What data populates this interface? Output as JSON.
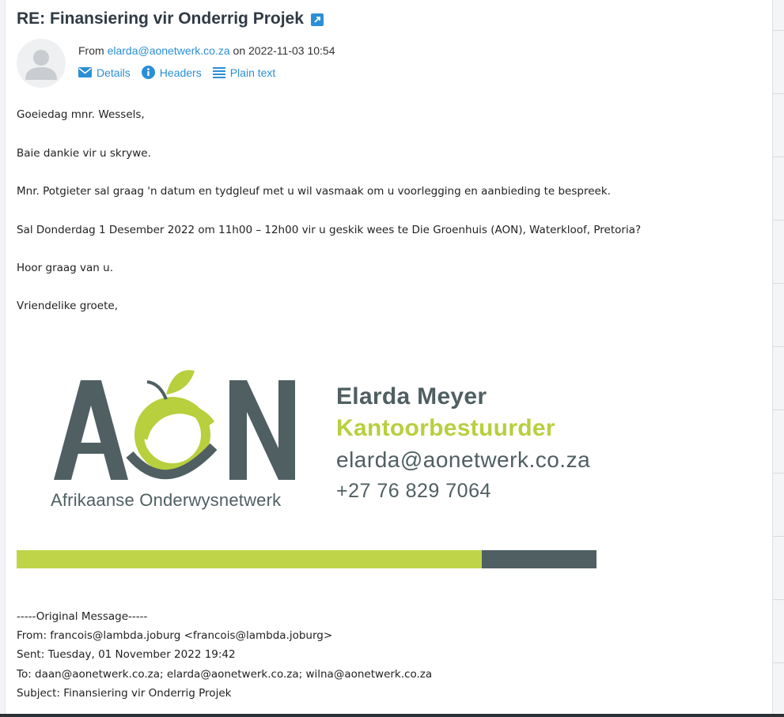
{
  "message": {
    "subject": "RE: Finansiering vir Onderrig Projek",
    "from_prefix": "From",
    "from_email": "elarda@aonetwerk.co.za",
    "date_text": "on 2022-11-03 10:54",
    "actions": {
      "details": "Details",
      "headers": "Headers",
      "plain_text": "Plain text"
    }
  },
  "body": {
    "lines": [
      "Goeiedag mnr. Wessels,",
      "Baie dankie vir u skrywe.",
      "Mnr. Potgieter sal graag 'n datum en tydgleuf met u wil vasmaak om u voorlegging en aanbieding te bespreek.",
      "Sal Donderdag 1 Desember 2022 om 11h00 – 12h00 vir u geskik wees te Die Groenhuis (AON), Waterkloof, Pretoria?",
      "Hoor graag van u.",
      "Vriendelike groete,"
    ]
  },
  "signature": {
    "logo_text": "AON",
    "logo_tagline": "Afrikaanse Onderwysnetwerk",
    "name": "Elarda Meyer",
    "title": "Kantoorbestuurder",
    "email": "elarda@aonetwerk.co.za",
    "phone": "+27 76 829 7064",
    "colors": {
      "green": "#c0d44a",
      "gray": "#4f5f62"
    }
  },
  "original": {
    "header": "-----Original Message-----",
    "from": "From: francois@lambda.joburg <francois@lambda.joburg>",
    "sent": "Sent: Tuesday, 01 November 2022 19:42",
    "to": "To: daan@aonetwerk.co.za; elarda@aonetwerk.co.za; wilna@aonetwerk.co.za",
    "subject": "Subject: Finansiering vir Onderrig Projek"
  },
  "icons": {
    "popout": "external-link-icon",
    "details": "envelope-icon",
    "headers": "info-icon",
    "plain_text": "lines-icon",
    "avatar": "user-avatar-icon"
  }
}
